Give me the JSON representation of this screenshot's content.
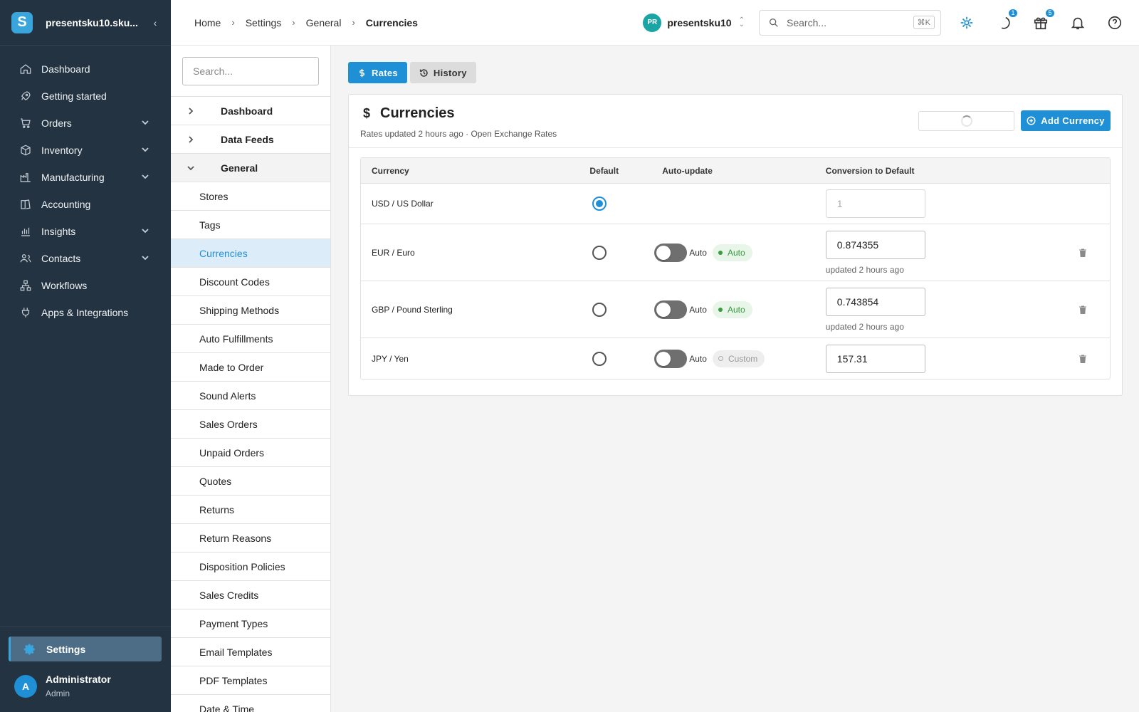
{
  "sidebar": {
    "app_name": "presentsku10.sku...",
    "logo_letter": "S",
    "items": [
      {
        "label": "Dashboard",
        "icon": "home-icon"
      },
      {
        "label": "Getting started",
        "icon": "rocket-icon"
      },
      {
        "label": "Orders",
        "icon": "cart-icon",
        "expandable": true
      },
      {
        "label": "Inventory",
        "icon": "box-icon",
        "expandable": true
      },
      {
        "label": "Manufacturing",
        "icon": "factory-icon",
        "expandable": true
      },
      {
        "label": "Accounting",
        "icon": "ledger-icon"
      },
      {
        "label": "Insights",
        "icon": "bar-chart-icon",
        "expandable": true
      },
      {
        "label": "Contacts",
        "icon": "people-icon",
        "expandable": true
      },
      {
        "label": "Workflows",
        "icon": "workflow-icon"
      },
      {
        "label": "Apps & Integrations",
        "icon": "plug-icon"
      }
    ],
    "settings_label": "Settings",
    "user": {
      "initial": "A",
      "name": "Administrator",
      "role": "Admin"
    }
  },
  "topbar": {
    "breadcrumbs": [
      "Home",
      "Settings",
      "General",
      "Currencies"
    ],
    "org_badge": "PR",
    "org_name": "presentsku10",
    "search_placeholder": "Search...",
    "search_shortcut": "⌘K",
    "badges": {
      "tasks": "1",
      "gifts": "5"
    }
  },
  "settings_nav": {
    "search_placeholder": "Search...",
    "groups": [
      {
        "label": "Dashboard",
        "open": false
      },
      {
        "label": "Data Feeds",
        "open": false
      },
      {
        "label": "General",
        "open": true
      }
    ],
    "items": [
      "Stores",
      "Tags",
      "Currencies",
      "Discount Codes",
      "Shipping Methods",
      "Auto Fulfillments",
      "Made to Order",
      "Sound Alerts",
      "Sales Orders",
      "Unpaid Orders",
      "Quotes",
      "Returns",
      "Return Reasons",
      "Disposition Policies",
      "Sales Credits",
      "Payment Types",
      "Email Templates",
      "PDF Templates",
      "Date & Time"
    ],
    "active_item": "Currencies"
  },
  "main": {
    "tabs": [
      {
        "label": "Rates",
        "active": true
      },
      {
        "label": "History",
        "active": false
      }
    ],
    "card_title": "Currencies",
    "card_subtitle": "Rates updated 2 hours ago · Open Exchange Rates",
    "add_button": "Add Currency",
    "columns": [
      "Currency",
      "Default",
      "Auto-update",
      "Conversion to Default"
    ],
    "toggle_label": "Auto",
    "rows": [
      {
        "currency": "USD / US Dollar",
        "default": true,
        "rate": "1",
        "status": null,
        "updated": null
      },
      {
        "currency": "EUR / Euro",
        "default": false,
        "rate": "0.874355",
        "status": "Auto",
        "updated": "updated 2 hours ago"
      },
      {
        "currency": "GBP / Pound Sterling",
        "default": false,
        "rate": "0.743854",
        "status": "Auto",
        "updated": "updated 2 hours ago"
      },
      {
        "currency": "JPY / Yen",
        "default": false,
        "rate": "157.31",
        "status": "Custom",
        "updated": null
      }
    ]
  },
  "colors": {
    "accent": "#1f8fd6",
    "sidebar_bg": "#243341",
    "auto_green": "#3a9b40"
  }
}
